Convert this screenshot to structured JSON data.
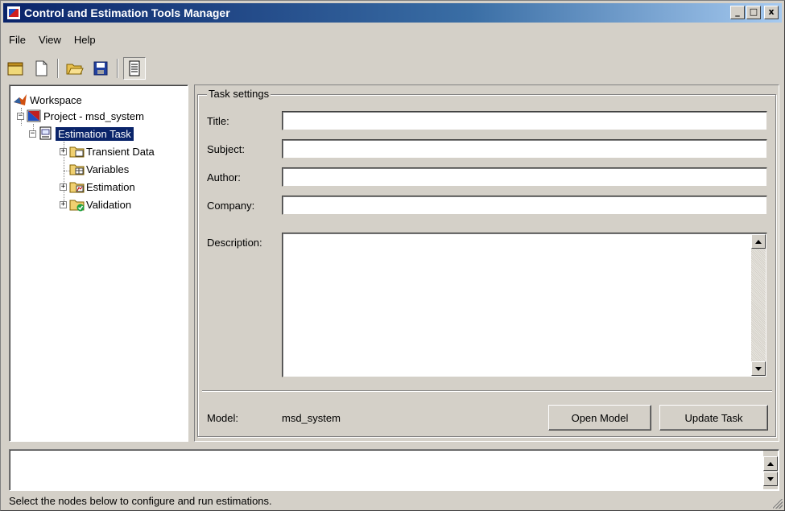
{
  "window": {
    "title": "Control and Estimation Tools Manager",
    "controls": {
      "minimize": "_",
      "maximize": "□",
      "close": "x"
    }
  },
  "menu": [
    "File",
    "View",
    "Help"
  ],
  "toolbar": {
    "buttons": [
      "new-project-icon",
      "new-task-icon",
      "open-folder-icon",
      "save-icon",
      "properties-icon"
    ]
  },
  "tree": {
    "workspace": "Workspace",
    "project": "Project - msd_system",
    "task": "Estimation Task",
    "children": [
      "Transient Data",
      "Variables",
      "Estimation",
      "Validation"
    ]
  },
  "task_settings": {
    "group_title": "Task settings",
    "title_label": "Title:",
    "title_value": "",
    "subject_label": "Subject:",
    "subject_value": "",
    "author_label": "Author:",
    "author_value": "",
    "company_label": "Company:",
    "company_value": "",
    "description_label": "Description:",
    "description_value": "",
    "model_label": "Model:",
    "model_value": "msd_system",
    "open_model_button": "Open Model",
    "update_task_button": "Update Task"
  },
  "status_bar": "Select the nodes below to configure and run estimations.",
  "colors": {
    "selection": "#0a246a",
    "titlebar_start": "#0a246a",
    "face": "#d4d0c8"
  }
}
